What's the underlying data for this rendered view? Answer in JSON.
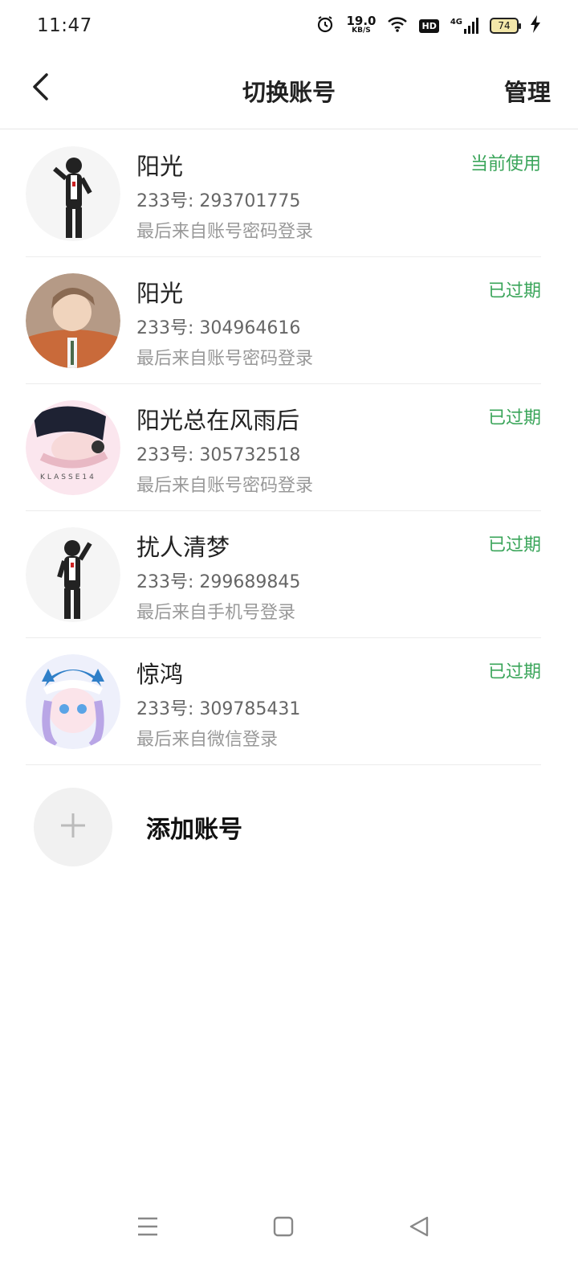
{
  "status_bar": {
    "time": "11:47",
    "net_speed_value": "19.0",
    "net_speed_unit": "KB/S",
    "hd": "HD",
    "signal": "4G",
    "battery": "74",
    "icons": [
      "alarm-icon",
      "wifi-icon",
      "hd-icon",
      "signal-icon",
      "battery-icon",
      "charging-icon"
    ]
  },
  "header": {
    "title": "切换账号",
    "manage_label": "管理",
    "back_icon": "chevron-left-icon"
  },
  "accounts": [
    {
      "name": "阳光",
      "id_line": "233号: 293701775",
      "login_line": "最后来自账号密码登录",
      "status": "当前使用"
    },
    {
      "name": "阳光",
      "id_line": "233号: 304964616",
      "login_line": "最后来自账号密码登录",
      "status": "已过期"
    },
    {
      "name": "阳光总在风雨后",
      "id_line": "233号: 305732518",
      "login_line": "最后来自账号密码登录",
      "status": "已过期"
    },
    {
      "name": "扰人清梦",
      "id_line": "233号: 299689845",
      "login_line": "最后来自手机号登录",
      "status": "已过期"
    },
    {
      "name": "惊鸿",
      "id_line": "233号: 309785431",
      "login_line": "最后来自微信登录",
      "status": "已过期"
    }
  ],
  "add_account": {
    "label": "添加账号",
    "icon": "plus-icon"
  },
  "colors": {
    "status_green": "#3aa55a",
    "divider": "#ececec"
  },
  "system_nav": {
    "icons": [
      "menu-icon",
      "home-icon",
      "back-triangle-icon"
    ]
  }
}
